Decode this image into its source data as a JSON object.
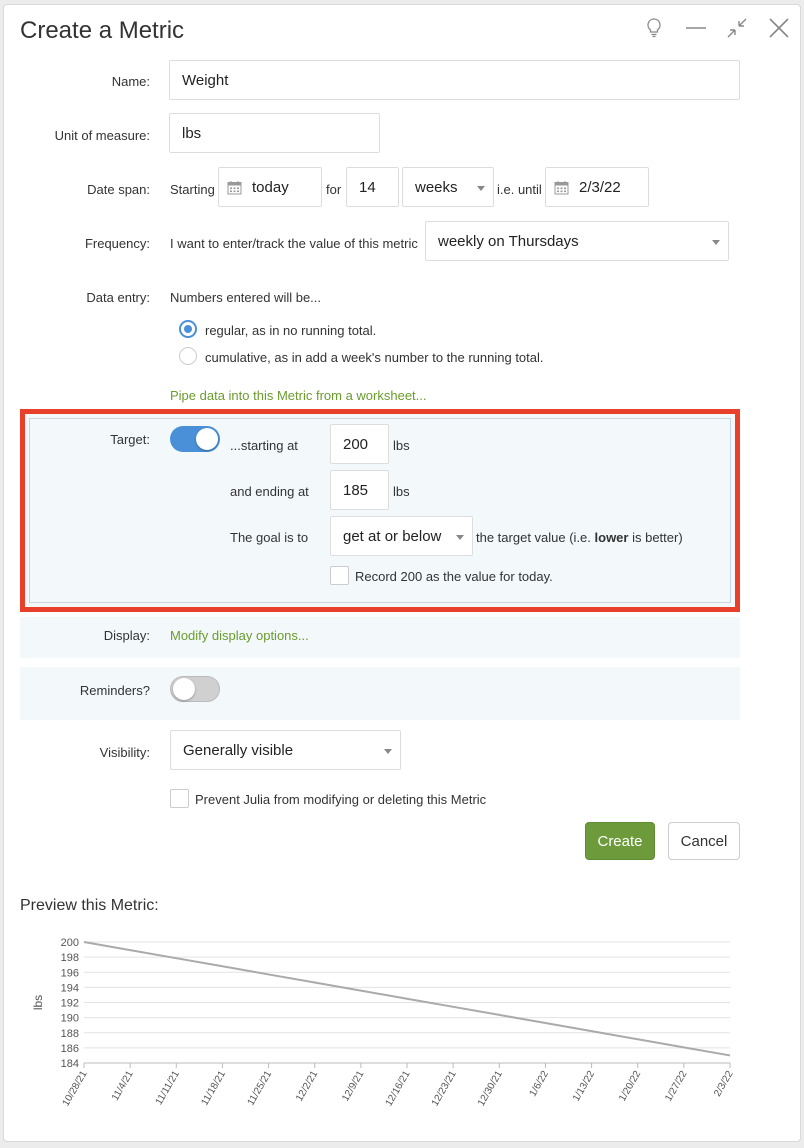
{
  "dialog": {
    "title": "Create a Metric"
  },
  "name": {
    "label": "Name:",
    "value": "Weight"
  },
  "unit": {
    "label": "Unit of measure:",
    "value": "lbs"
  },
  "date_span": {
    "label": "Date span:",
    "starting_text": "Starting",
    "start_value": "today",
    "for_text": "for",
    "count_value": "14",
    "period_value": "weeks",
    "until_text": "i.e. until",
    "end_value": "2/3/22"
  },
  "frequency": {
    "label": "Frequency:",
    "text": "I want to enter/track the value of this metric",
    "value": "weekly on Thursdays"
  },
  "data_entry": {
    "label": "Data entry:",
    "text": "Numbers entered will be...",
    "option_regular": "regular, as in no running total.",
    "option_cumulative": "cumulative, as in add a week's number to the running total.",
    "pipe_link": "Pipe data into this Metric from a worksheet..."
  },
  "target": {
    "label": "Target:",
    "starting_text": "...starting at",
    "start_value": "200",
    "start_unit": "lbs",
    "ending_text": "and ending at",
    "end_value": "185",
    "end_unit": "lbs",
    "goal_text": "The goal is to",
    "goal_value": "get at or below",
    "target_pre": "the target value (i.e. ",
    "target_bold": "lower",
    "target_post": " is better)",
    "record_text": "Record 200 as the value for today."
  },
  "display": {
    "label": "Display:",
    "link": "Modify display options..."
  },
  "reminders": {
    "label": "Reminders?"
  },
  "visibility": {
    "label": "Visibility:",
    "value": "Generally visible",
    "prevent_text": "Prevent Julia from modifying or deleting this Metric"
  },
  "buttons": {
    "create": "Create",
    "cancel": "Cancel"
  },
  "preview": {
    "title": "Preview this Metric:"
  },
  "colors": {
    "accent": "#4a90d9",
    "link": "#6a9c2e",
    "create": "#6d9a3b",
    "highlight": "#e8402a",
    "line": "#aaaaaa"
  },
  "chart_data": {
    "type": "line",
    "ylabel": "lbs",
    "ylim": [
      184,
      200
    ],
    "yticks": [
      184,
      186,
      188,
      190,
      192,
      194,
      196,
      198,
      200
    ],
    "x": [
      "10/28/21",
      "11/4/21",
      "11/11/21",
      "11/18/21",
      "11/25/21",
      "12/2/21",
      "12/9/21",
      "12/16/21",
      "12/23/21",
      "12/30/21",
      "1/6/22",
      "1/13/22",
      "1/20/22",
      "1/27/22",
      "2/3/22"
    ],
    "series": [
      {
        "values": [
          200,
          198.93,
          197.86,
          196.79,
          195.71,
          194.64,
          193.57,
          192.5,
          191.43,
          190.36,
          189.29,
          188.21,
          187.14,
          186.07,
          185
        ]
      }
    ],
    "grid": true
  }
}
